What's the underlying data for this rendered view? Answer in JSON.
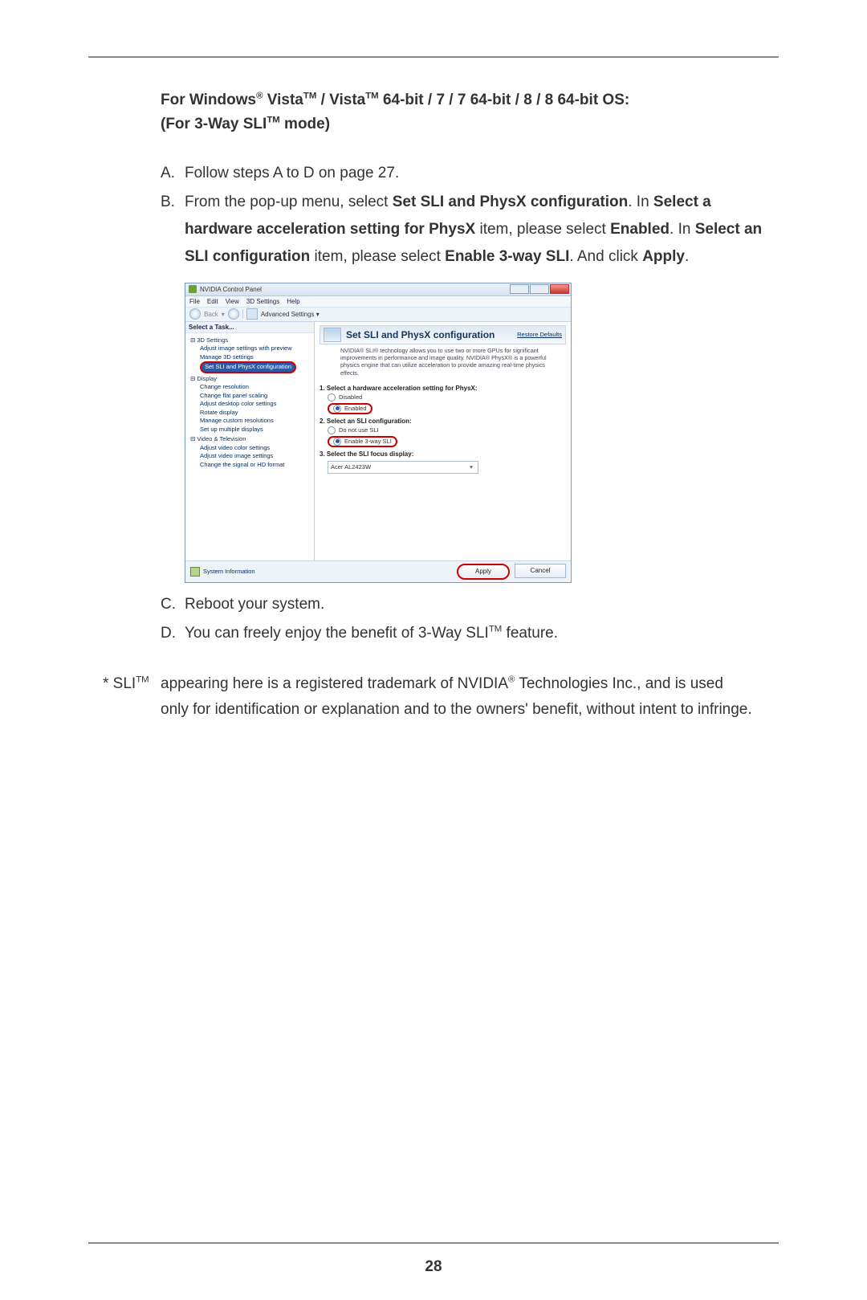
{
  "heading": {
    "pre_vista": "For Windows",
    "reg": "®",
    "vista": " Vista",
    "tm": "TM",
    "after_vista": " / Vista",
    "after_vista2": " 64-bit / 7 / 7 64-bit / 8 / 8 64-bit OS:",
    "line2_pre": "(For 3-Way SLI",
    "line2_post": " mode)"
  },
  "steps": {
    "A": {
      "label": "A.",
      "text": "Follow steps A to D on page 27."
    },
    "B": {
      "label": "B.",
      "t1": "From the pop-up menu, select ",
      "b1": "Set SLI and PhysX configuration",
      "t2": ". In ",
      "b2": "Select a hardware acceleration setting for PhysX",
      "t3": " item, please select ",
      "b3": "Enabled",
      "t4": ". In ",
      "b4": "Select an SLI configuration",
      "t5": " item, please select ",
      "b5": "Enable 3-way SLI",
      "t6": ". And click ",
      "b6": "Apply",
      "t7": "."
    },
    "C": {
      "label": "C.",
      "text": "Reboot your system."
    },
    "D": {
      "label": "D.",
      "t1": "You can freely enjoy the benefit of 3-Way SLI",
      "t2": " feature."
    }
  },
  "ncp": {
    "title": "NVIDIA Control Panel",
    "menus": [
      "File",
      "Edit",
      "View",
      "3D Settings",
      "Help"
    ],
    "toolbar_label": "Advanced Settings ▾",
    "side_head": "Select a Task...",
    "tree": {
      "grp1": "⊟ 3D Settings",
      "n1": "Adjust image settings with preview",
      "n2": "Manage 3D settings",
      "n3": "Set SLI and PhysX configuration",
      "grp2": "⊟ Display",
      "d1": "Change resolution",
      "d2": "Change flat panel scaling",
      "d3": "Adjust desktop color settings",
      "d4": "Rotate display",
      "d5": "Manage custom resolutions",
      "d6": "Set up multiple displays",
      "grp3": "⊟ Video & Television",
      "v1": "Adjust video color settings",
      "v2": "Adjust video image settings",
      "v3": "Change the signal or HD format"
    },
    "main_title": "Set SLI and PhysX configuration",
    "restore": "Restore Defaults",
    "desc": "NVIDIA® SLI® technology allows you to use two or more GPUs for significant improvements in performance and image quality. NVIDIA® PhysX® is a powerful physics engine that can utilize acceleration to provide amazing real-time physics effects.",
    "sec1": "1. Select a hardware acceleration setting for PhysX:",
    "opt_disabled": "Disabled",
    "opt_enabled": "Enabled",
    "sec2": "2. Select an SLI configuration:",
    "opt_no_sli": "Do not use SLI",
    "opt_3way": "Enable 3-way SLI",
    "sec3": "3. Select the SLI focus display:",
    "focus_value": "Acer AL2423W",
    "sysinfo": "System Information",
    "btn_apply": "Apply",
    "btn_cancel": "Cancel"
  },
  "footnote": {
    "marker": "* SLI",
    "l1a": " appearing here is a registered trademark of NVIDIA",
    "l1b": " Technologies Inc., and is used",
    "l2": "only for identification or explanation and to the owners' benefit, without intent to infringe."
  },
  "page_number": "28"
}
